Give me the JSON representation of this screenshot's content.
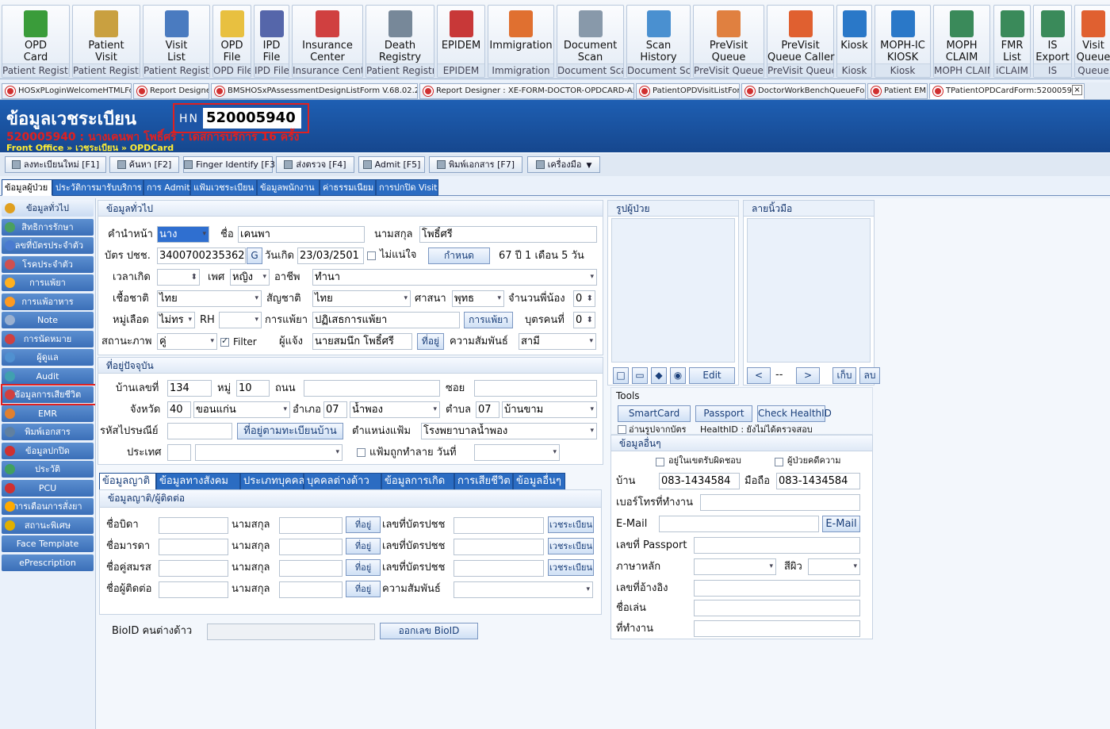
{
  "ribbon": [
    {
      "l1": "OPD",
      "l2": "Card",
      "grp": "Patient Registry",
      "icon": "opd-card-icon",
      "c": "#3a9c3a"
    },
    {
      "l1": "Patient",
      "l2": "Visit",
      "grp": "Patient Registry",
      "icon": "patient-visit-icon",
      "c": "#c9a040"
    },
    {
      "l1": "Visit",
      "l2": "List",
      "grp": "Patient Registry",
      "icon": "visit-list-icon",
      "c": "#4a7bc0"
    },
    {
      "l1": "OPD",
      "l2": "File",
      "grp": "OPD File",
      "icon": "folder-icon",
      "c": "#e8c040"
    },
    {
      "l1": "IPD",
      "l2": "File",
      "grp": "IPD File",
      "icon": "file-cabinet-icon",
      "c": "#5566aa"
    },
    {
      "l1": "Insurance",
      "l2": "Center",
      "grp": "Insurance Center",
      "icon": "insurance-icon",
      "c": "#d04040"
    },
    {
      "l1": "Death",
      "l2": "Registry",
      "grp": "Patient Registry",
      "icon": "death-registry-icon",
      "c": "#778899"
    },
    {
      "l1": "EPIDEM",
      "l2": "",
      "grp": "EPIDEM",
      "icon": "shield-virus-icon",
      "c": "#c83838"
    },
    {
      "l1": "Immigration",
      "l2": "",
      "grp": "Immigration",
      "icon": "officer-icon",
      "c": "#e07030"
    },
    {
      "l1": "Document",
      "l2": "Scan",
      "grp": "Document Scan",
      "icon": "scanner-icon",
      "c": "#8899aa"
    },
    {
      "l1": "Scan",
      "l2": "History",
      "grp": "Document Scan",
      "icon": "scan-history-icon",
      "c": "#4a90d0"
    },
    {
      "l1": "PreVisit",
      "l2": "Queue",
      "grp": "PreVisit Queue",
      "icon": "queue-icon",
      "c": "#e08040"
    },
    {
      "l1": "PreVisit",
      "l2": "Queue Caller",
      "grp": "PreVisit Queue",
      "icon": "queue-caller-icon",
      "c": "#e06030"
    },
    {
      "l1": "Kiosk",
      "l2": "",
      "grp": "Kiosk",
      "icon": "kiosk-icon",
      "c": "#2a78c8"
    },
    {
      "l1": "MOPH-IC",
      "l2": "KIOSK",
      "grp": "Kiosk",
      "icon": "moph-kiosk-icon",
      "c": "#2a78c8"
    },
    {
      "l1": "MOPH",
      "l2": "CLAIM",
      "grp": "MOPH CLAIM",
      "icon": "claim-icon",
      "c": "#3a8a5a"
    },
    {
      "l1": "FMR",
      "l2": "List",
      "grp": "iCLAIM",
      "icon": "fmr-list-icon",
      "c": "#3a8a5a"
    },
    {
      "l1": "IS",
      "l2": "Export",
      "grp": "IS",
      "icon": "export-icon",
      "c": "#3a8a5a"
    },
    {
      "l1": "Visit",
      "l2": "Queue",
      "grp": "Queue",
      "icon": "visit-queue-icon",
      "c": "#e06030"
    }
  ],
  "doc_tabs": [
    "HOSxPLoginWelcomeHTMLForm",
    "Report Designer",
    "BMSHOSxPAssessmentDesignListForm V.68.02.24.001",
    "Report Designer : XE-FORM-DOCTOR-OPDCARD-A5 OLD",
    "PatientOPDVisitListForm",
    "DoctorWorkBenchQueueForm",
    "Patient EMR",
    "TPatientOPDCardForm:520005940"
  ],
  "header": {
    "title": "ข้อมูลเวชระเบียน",
    "hn_label": "HN",
    "hn": "520005940",
    "patient": "520005940 : นางเคนพา โพธิ์ศรี : เดสการบริการ 16 ครั้ง",
    "breadcrumb": "Front Office » เวชระเบียน » OPDCard"
  },
  "toolbar": [
    "ลงทะเบียนใหม่ [F1]",
    "ค้นหา [F2]",
    "Finger Identify [F3]",
    "ส่งตรวจ [F4]",
    "Admit [F5]",
    "พิมพ์เอกสาร [F7]",
    "เครื่องมือ"
  ],
  "content_tabs": [
    "ข้อมูลผู้ป่วย",
    "ประวัติการมารับบริการ",
    "การ Admit",
    "แฟ้มเวชระเบียน",
    "ข้อมูลพนักงาน",
    "ค่าธรรมเนียม",
    "การปกปิด Visit"
  ],
  "sidebar": [
    "ข้อมูลทั่วไป",
    "สิทธิการรักษา",
    "เลขที่บัตรประจำตัว",
    "โรคประจำตัว",
    "การแพ้ยา",
    "การแพ้อาหาร",
    "Note",
    "การนัดหมาย",
    "ผู้ดูแล",
    "Audit",
    "ข้อมูลการเสียชีวิต",
    "EMR",
    "พิมพ์เอกสาร",
    "ข้อมูลปกปิด",
    "ประวัติ",
    "PCU",
    "การเตือนการสั่งยา",
    "สถานะพิเศษ",
    "Face Template",
    "ePrescription"
  ],
  "general": {
    "section": "ข้อมูลทั่วไป",
    "prefix_label": "คำนำหน้า",
    "prefix": "นาง",
    "name_label": "ชื่อ",
    "name": "เคนพา",
    "surname_label": "นามสกุล",
    "surname": "โพธิ์ศรี",
    "cid_label": "บัตร ปชช.",
    "cid": "3400700235362",
    "g_btn": "G",
    "dob_label": "วันเกิด",
    "dob": "23/03/2501",
    "unsure_label": "ไม่แน่ใจ",
    "assign_btn": "กำหนด",
    "age": "67 ปี 1 เดือน 5 วัน",
    "birthtime_label": "เวลาเกิด",
    "sex_label": "เพศ",
    "sex": "หญิง",
    "occ_label": "อาชีพ",
    "occ": "ทำนา",
    "race_label": "เชื้อชาติ",
    "race": "ไทย",
    "nat_label": "สัญชาติ",
    "nat": "ไทย",
    "rel_label": "ศาสนา",
    "rel": "พุทธ",
    "sib_label": "จำนวนพี่น้อง",
    "sib": "0",
    "blood_label": "หมู่เลือด",
    "blood": "ไม่ทร",
    "rh_label": "RH",
    "allergy_label": "การแพ้ยา",
    "allergy": "ปฏิเสธการแพ้ยา",
    "allergy_btn": "การแพ้ยา",
    "child_label": "บุตรคนที่",
    "child": "0",
    "marital_label": "สถานะภาพ",
    "marital": "คู่",
    "filter_label": "Filter",
    "informant_label": "ผู้แจ้ง",
    "informant": "นายสมนึก โพธิ์ศรี",
    "addr_btn": "ที่อยู่",
    "relation_label": "ความสัมพันธ์",
    "relation": "สามี"
  },
  "address": {
    "section": "ที่อยู่ปัจจุบัน",
    "house_label": "บ้านเลขที่",
    "house": "134",
    "moo_label": "หมู่",
    "moo": "10",
    "road_label": "ถนน",
    "soi_label": "ซอย",
    "prov_label": "จังหวัด",
    "prov_code": "40",
    "prov": "ขอนแก่น",
    "amp_label": "อำเภอ",
    "amp_code": "07",
    "amp": "น้ำพอง",
    "tmb_label": "ตำบล",
    "tmb_code": "07",
    "tmb": "บ้านขาม",
    "zip_label": "รหัสไปรษณีย์",
    "reg_addr_btn": "ที่อยู่ตามทะเบียนบ้าน",
    "fileloc_label": "ตำแหน่งแฟ้ม",
    "fileloc": "โรงพยาบาลน้ำพอง",
    "country_label": "ประเทศ",
    "destroyed_label": "แฟ้มถูกทำลาย วันที่"
  },
  "sub_tabs": [
    "ข้อมูลญาติ",
    "ข้อมูลทางสังคม",
    "ประเภทบุคคล",
    "บุคคลต่างด้าว",
    "ข้อมูลการเกิด",
    "การเสียชีวิต",
    "ข้อมูลอื่นๆ"
  ],
  "relatives": {
    "section": "ข้อมูลญาติ/ผู้ติดต่อ",
    "rows": [
      "ชื่อบิดา",
      "ชื่อมารดา",
      "ชื่อคู่สมรส",
      "ชื่อผู้ติดต่อ"
    ],
    "surname": "นามสกุล",
    "addr": "ที่อยู่",
    "cid": "เลขที่บัตรปชช",
    "reg": "เวชระเบียน",
    "relation": "ความสัมพันธ์"
  },
  "bio": {
    "label": "BioID คนต่างด้าว",
    "btn": "ออกเลข BioID"
  },
  "photo": {
    "title": "รูปผู้ป่วย",
    "edit": "Edit"
  },
  "finger": {
    "title": "ลายนิ้วมือ",
    "prev": "<",
    "sep": "--",
    "next": ">",
    "save": "เก็บ",
    "del": "ลบ"
  },
  "tools": {
    "title": "Tools",
    "smartcard": "SmartCard",
    "passport": "Passport",
    "healthid": "Check HealthID",
    "readphoto": "อ่านรูปจากบัตร",
    "healthid_status": "HealthID : ยังไม่ได้ตรวจสอบ"
  },
  "other": {
    "title": "ข้อมูลอื่นๆ",
    "in_area": "อยู่ในเขตรับผิดชอบ",
    "case": "ผู้ป่วยคดีความ",
    "home_label": "บ้าน",
    "home": "083-1434584",
    "mobile_label": "มือถือ",
    "mobile": "083-1434584",
    "work_phone": "เบอร์โทรที่ทำงาน",
    "email": "E-Mail",
    "email_btn": "E-Mail",
    "passport": "เลขที่ Passport",
    "lang": "ภาษาหลัก",
    "skin": "สีผิว",
    "ref": "เลขที่อ้างอิง",
    "nick": "ชื่อเล่น",
    "work": "ที่ทำงาน"
  }
}
